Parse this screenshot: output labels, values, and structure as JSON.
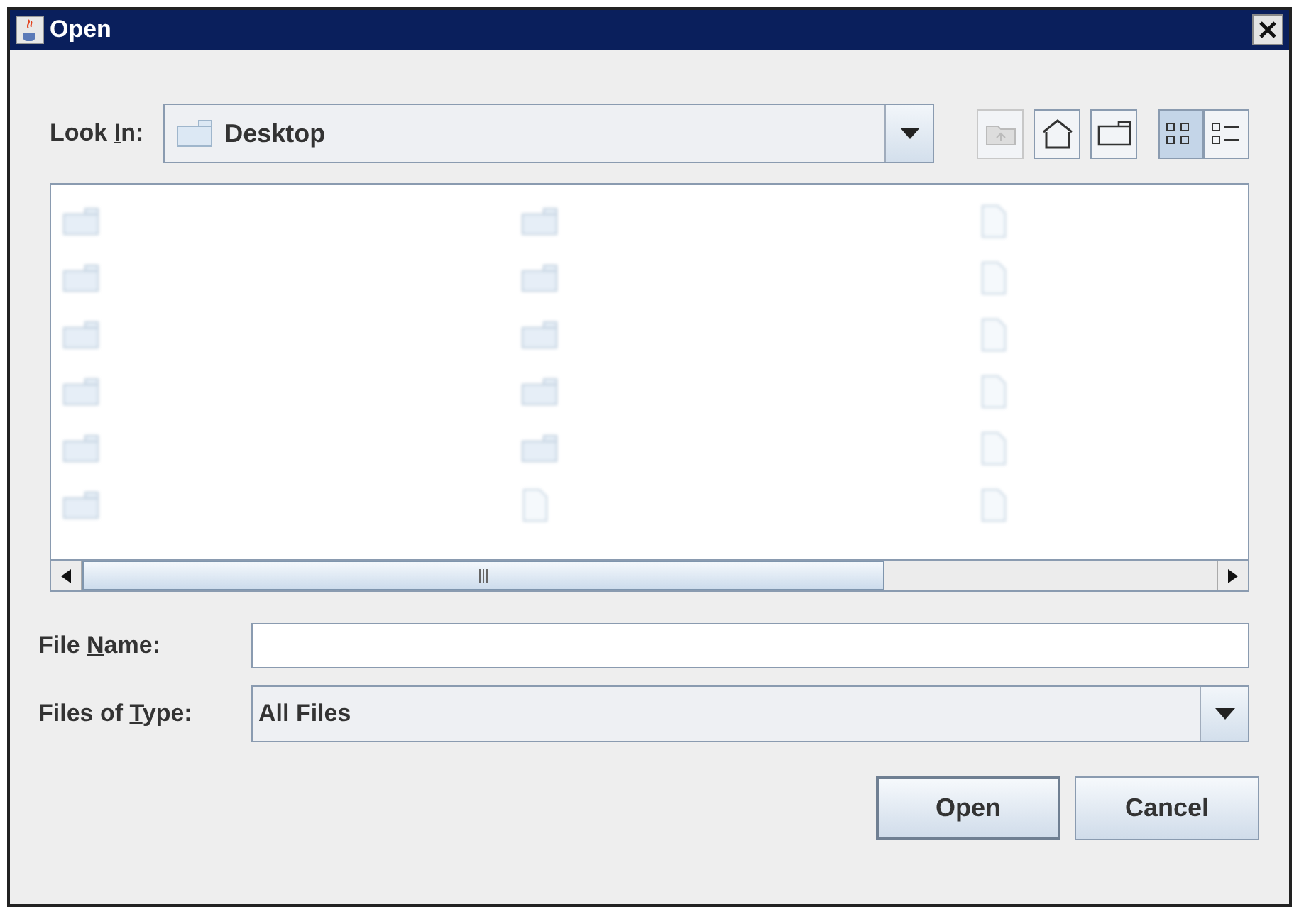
{
  "window": {
    "title": "Open"
  },
  "look_in": {
    "label": {
      "before": "Look ",
      "mnemonic": "I",
      "after": "n:"
    },
    "value": "Desktop"
  },
  "toolbar": [
    {
      "kind": "up",
      "disabled": true,
      "selected": false
    },
    {
      "kind": "home",
      "disabled": false,
      "selected": false
    },
    {
      "kind": "new_folder",
      "disabled": false,
      "selected": false
    },
    {
      "kind": "list_view",
      "disabled": false,
      "selected": true
    },
    {
      "kind": "details_view",
      "disabled": false,
      "selected": false
    }
  ],
  "file_list": {
    "columns": [
      [
        {
          "kind": "folder"
        },
        {
          "kind": "folder"
        },
        {
          "kind": "folder"
        },
        {
          "kind": "folder"
        },
        {
          "kind": "folder"
        },
        {
          "kind": "folder"
        }
      ],
      [
        {
          "kind": "folder"
        },
        {
          "kind": "folder"
        },
        {
          "kind": "folder"
        },
        {
          "kind": "folder"
        },
        {
          "kind": "folder"
        },
        {
          "kind": "file"
        }
      ],
      [
        {
          "kind": "file"
        },
        {
          "kind": "file"
        },
        {
          "kind": "file"
        },
        {
          "kind": "file"
        },
        {
          "kind": "file"
        },
        {
          "kind": "file"
        }
      ]
    ]
  },
  "file_name": {
    "label": {
      "before": "File ",
      "mnemonic": "N",
      "after": "ame:"
    }
  },
  "file_type": {
    "label": {
      "before": "Files of ",
      "mnemonic": "T",
      "after": "ype:"
    },
    "value": "All Files"
  },
  "buttons": [
    {
      "label": "Open",
      "default": true
    },
    {
      "label": "Cancel",
      "default": false
    }
  ]
}
